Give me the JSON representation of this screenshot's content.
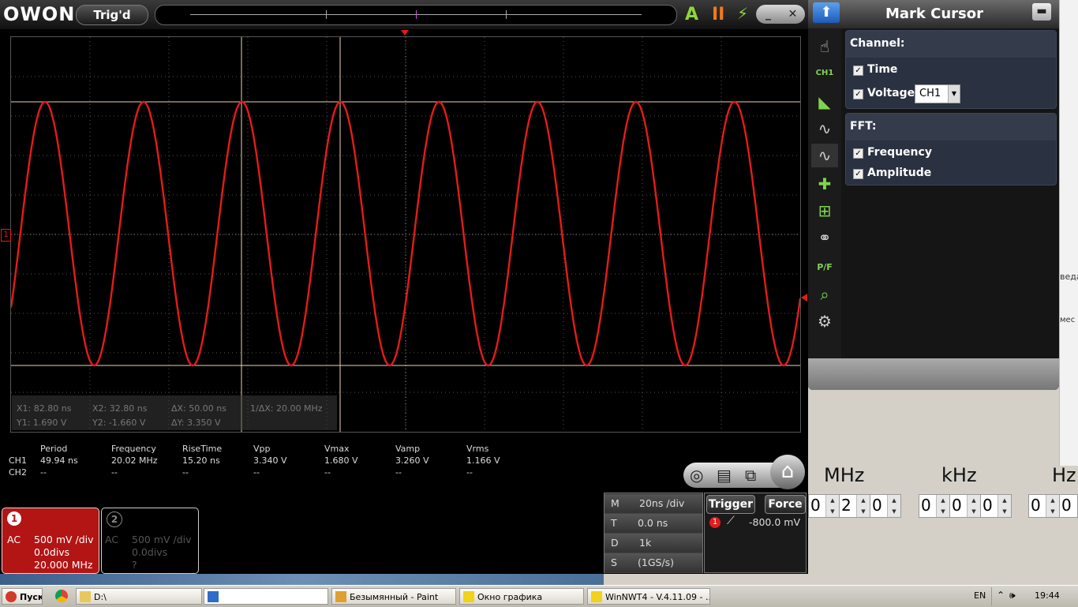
{
  "app": {
    "logo": "OWON",
    "trig_status": "Trig'd",
    "auto_icon": "A",
    "pause_icon": "II",
    "lightning_icon": "lightning",
    "minimize": "_",
    "close": "✕"
  },
  "screen": {
    "channel_marker": "1",
    "trace_color": "#e41b1b",
    "cursors": {
      "x1": "X1: 82.80 ns",
      "x2": "X2: 32.80 ns",
      "dx": "ΔX: 50.00 ns",
      "inv_dx": "1/ΔX: 20.00 MHz",
      "y1": "Y1: 1.690 V",
      "y2": "Y2: -1.660 V",
      "dy": "ΔY: 3.350 V"
    }
  },
  "measurements": {
    "headers": [
      "Period",
      "Frequency",
      "RiseTime",
      "Vpp",
      "Vmax",
      "Vamp",
      "Vrms"
    ],
    "ch1_label": "CH1",
    "ch2_label": "CH2",
    "ch1": [
      "49.94 ns",
      "20.02 MHz",
      "15.20 ns",
      "3.340 V",
      "1.680 V",
      "3.260 V",
      "1.166 V"
    ],
    "ch2": [
      "--",
      "--",
      "--",
      "--",
      "--",
      "--",
      "--"
    ]
  },
  "channels": {
    "ch1": {
      "num": "1",
      "coupling": "AC",
      "scale": "500 mV /div",
      "offset": "0.0divs",
      "freq": "20.000 MHz"
    },
    "ch2": {
      "num": "2",
      "coupling": "AC",
      "scale": "500 mV /div",
      "offset": "0.0divs",
      "freq": "?"
    }
  },
  "timebase": {
    "m_label": "M",
    "m_value": "20ns /div",
    "t_label": "T",
    "t_value": "0.0 ns",
    "d_label": "D",
    "d_value": "1k",
    "s_label": "S",
    "s_value": "(1GS/s)"
  },
  "trigger": {
    "trigger_btn": "Trigger",
    "force_btn": "Force",
    "source": "1",
    "level": "-800.0 mV"
  },
  "mark_cursor": {
    "title": "Mark Cursor",
    "channel_heading": "Channel:",
    "time_label": "Time",
    "voltage_label": "Voltage",
    "voltage_select": "CH1",
    "fft_heading": "FFT:",
    "frequency_label": "Frequency",
    "amplitude_label": "Amplitude"
  },
  "freq_setter": {
    "mhz_label": "MHz",
    "khz_label": "kHz",
    "hz_label": "Hz",
    "mhz_digits": [
      "0",
      "2",
      "0"
    ],
    "khz_digits": [
      "0",
      "0",
      "0"
    ],
    "hz_digits": [
      "0",
      "0"
    ]
  },
  "background_window": {
    "fragment1": "веда",
    "fragment2": "мес"
  },
  "taskbar": {
    "start": "Пуск",
    "item1": "D:\\",
    "item2": "",
    "item3": "Безымянный - Paint",
    "item4": "Окно графика",
    "item5": "WinNWT4 - V.4.11.09 - ...",
    "lang": "EN",
    "clock": "19:44"
  }
}
